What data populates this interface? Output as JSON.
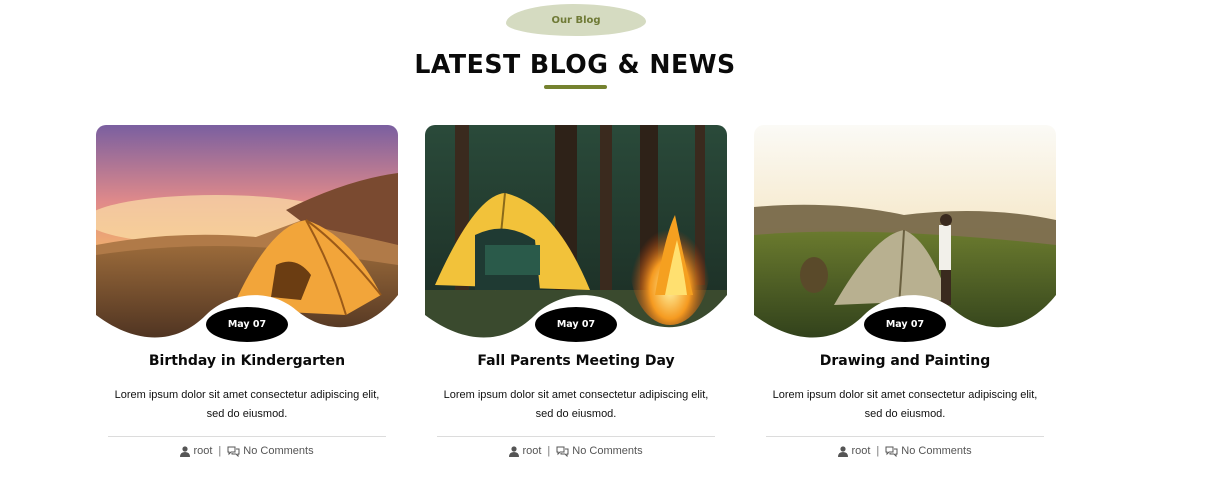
{
  "section": {
    "badge": "Our Blog",
    "title": "LATEST BLOG & NEWS",
    "accent_color": "#75822f",
    "badge_bg": "#d5dbc1"
  },
  "posts": [
    {
      "date": "May 07",
      "title": "Birthday in Kindergarten",
      "excerpt": "Lorem ipsum dolor sit amet consectetur adipiscing elit, sed do eiusmod.",
      "author": "root",
      "separator": "|",
      "comments": "No Comments",
      "image": "sunset-tent-photo"
    },
    {
      "date": "May 07",
      "title": "Fall Parents Meeting Day",
      "excerpt": "Lorem ipsum dolor sit amet consectetur adipiscing elit, sed do eiusmod.",
      "author": "root",
      "separator": "|",
      "comments": "No Comments",
      "image": "campfire-tent-photo"
    },
    {
      "date": "May 07",
      "title": "Drawing and Painting",
      "excerpt": "Lorem ipsum dolor sit amet consectetur adipiscing elit, sed do eiusmod.",
      "author": "root",
      "separator": "|",
      "comments": "No Comments",
      "image": "hillside-campers-photo"
    }
  ]
}
